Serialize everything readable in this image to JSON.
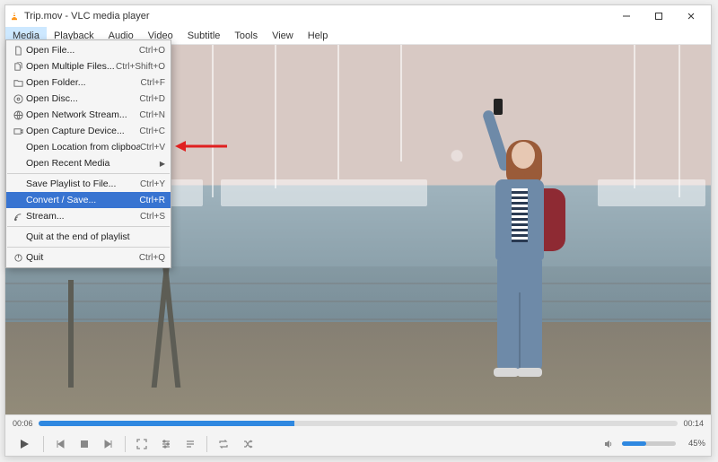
{
  "title": "Trip.mov - VLC media player",
  "menubar": [
    "Media",
    "Playback",
    "Audio",
    "Video",
    "Subtitle",
    "Tools",
    "View",
    "Help"
  ],
  "menu_open_index": 0,
  "media_menu": {
    "groups": [
      [
        {
          "icon": "file",
          "label": "Open File...",
          "shortcut": "Ctrl+O"
        },
        {
          "icon": "files",
          "label": "Open Multiple Files...",
          "shortcut": "Ctrl+Shift+O"
        },
        {
          "icon": "folder",
          "label": "Open Folder...",
          "shortcut": "Ctrl+F"
        },
        {
          "icon": "disc",
          "label": "Open Disc...",
          "shortcut": "Ctrl+D"
        },
        {
          "icon": "network",
          "label": "Open Network Stream...",
          "shortcut": "Ctrl+N"
        },
        {
          "icon": "capture",
          "label": "Open Capture Device...",
          "shortcut": "Ctrl+C"
        },
        {
          "icon": "",
          "label": "Open Location from clipboard",
          "shortcut": "Ctrl+V"
        },
        {
          "icon": "",
          "label": "Open Recent Media",
          "shortcut": "",
          "submenu": true
        }
      ],
      [
        {
          "icon": "",
          "label": "Save Playlist to File...",
          "shortcut": "Ctrl+Y"
        },
        {
          "icon": "",
          "label": "Convert / Save...",
          "shortcut": "Ctrl+R",
          "highlight": true
        },
        {
          "icon": "stream",
          "label": "Stream...",
          "shortcut": "Ctrl+S"
        }
      ],
      [
        {
          "icon": "",
          "label": "Quit at the end of playlist",
          "shortcut": ""
        }
      ],
      [
        {
          "icon": "quit",
          "label": "Quit",
          "shortcut": "Ctrl+Q"
        }
      ]
    ]
  },
  "playback": {
    "elapsed": "00:06",
    "total": "00:14",
    "progress_pct": 40,
    "volume_pct": 45,
    "volume_label": "45%"
  },
  "controls": {
    "play": "▶",
    "prev": "previous",
    "stop": "stop",
    "next": "next",
    "fullscreen": "fullscreen",
    "ext": "extended-settings",
    "playlist": "playlist",
    "loop": "loop",
    "shuffle": "shuffle",
    "speaker": "speaker"
  }
}
